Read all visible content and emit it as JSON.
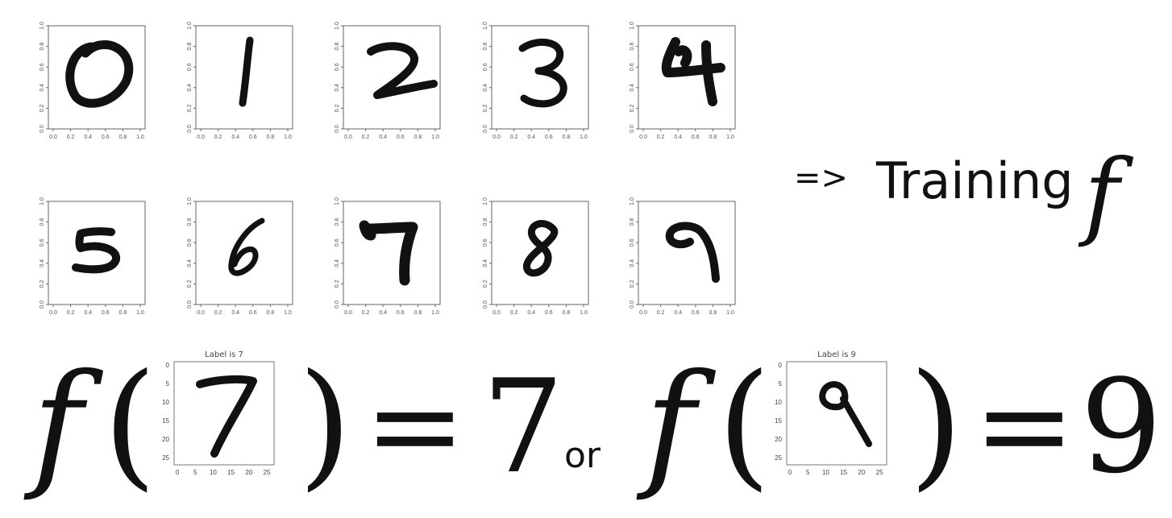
{
  "digit_grid": {
    "y_ticks": [
      "0.0",
      "0.2",
      "0.4",
      "0.6",
      "0.8",
      "1.0"
    ],
    "x_ticks": [
      "0.0",
      "0.2",
      "0.4",
      "0.6",
      "0.8",
      "1.0"
    ],
    "samples": [
      {
        "digit": "0"
      },
      {
        "digit": "1"
      },
      {
        "digit": "2"
      },
      {
        "digit": "3"
      },
      {
        "digit": "4"
      },
      {
        "digit": "5"
      },
      {
        "digit": "6"
      },
      {
        "digit": "7"
      },
      {
        "digit": "8"
      },
      {
        "digit": "9"
      }
    ]
  },
  "training": {
    "arrow": "=>",
    "label": "Training",
    "function_symbol": "f"
  },
  "formula": {
    "function_symbol": "f",
    "open_paren": "(",
    "close_paren": ")",
    "equals": "=",
    "connector": "or",
    "examples": [
      {
        "title": "Label is 7",
        "digit": "7",
        "result": "7",
        "y_ticks": [
          "0",
          "5",
          "10",
          "15",
          "20",
          "25"
        ],
        "x_ticks": [
          "0",
          "5",
          "10",
          "15",
          "20",
          "25"
        ]
      },
      {
        "title": "Label is 9",
        "digit": "9",
        "result": "9",
        "y_ticks": [
          "0",
          "5",
          "10",
          "15",
          "20",
          "25"
        ],
        "x_ticks": [
          "0",
          "5",
          "10",
          "15",
          "20",
          "25"
        ]
      }
    ]
  }
}
